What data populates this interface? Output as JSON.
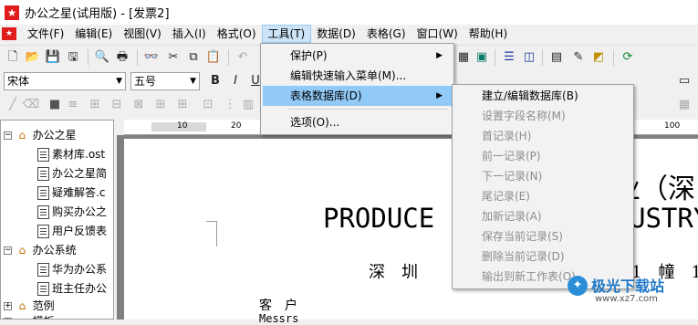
{
  "window": {
    "title": "办公之星(试用版) - [发票2]"
  },
  "menubar": {
    "items": [
      "文件(F)",
      "编辑(E)",
      "视图(V)",
      "插入(I)",
      "格式(O)",
      "工具(T)",
      "数据(D)",
      "表格(G)",
      "窗口(W)",
      "帮助(H)"
    ],
    "active": "工具(T)"
  },
  "format_bar": {
    "font_name": "宋体",
    "font_size": "五号"
  },
  "tools_menu": {
    "items": [
      {
        "label": "保护(P)",
        "submenu": true
      },
      {
        "label": "编辑快速输入菜单(M)...",
        "submenu": false
      },
      {
        "label": "表格数据库(D)",
        "submenu": true,
        "highlighted": true
      },
      {
        "label": "选项(O)...",
        "submenu": false
      }
    ]
  },
  "database_submenu": {
    "items": [
      {
        "label": "建立/编辑数据库(B)",
        "enabled": true
      },
      {
        "label": "设置字段名称(M)",
        "enabled": false
      },
      {
        "label": "首记录(H)",
        "enabled": false
      },
      {
        "label": "前一记录(P)",
        "enabled": false
      },
      {
        "label": "下一记录(N)",
        "enabled": false
      },
      {
        "label": "尾记录(E)",
        "enabled": false
      },
      {
        "label": "加新记录(A)",
        "enabled": false
      },
      {
        "label": "保存当前记录(S)",
        "enabled": false
      },
      {
        "label": "删除当前记录(D)",
        "enabled": false
      },
      {
        "label": "输出到新工作表(O)",
        "enabled": false
      }
    ]
  },
  "tree": {
    "nodes": [
      {
        "label": "办公之星",
        "type": "folder",
        "expanded": true
      },
      {
        "label": "素材库.ost",
        "type": "doc"
      },
      {
        "label": "办公之星简",
        "type": "doc"
      },
      {
        "label": "疑难解答.c",
        "type": "doc"
      },
      {
        "label": "购买办公之",
        "type": "doc"
      },
      {
        "label": "用户反馈表",
        "type": "doc"
      },
      {
        "label": "办公系统",
        "type": "folder",
        "expanded": true
      },
      {
        "label": "华为办公系",
        "type": "doc"
      },
      {
        "label": "班主任办公",
        "type": "doc"
      },
      {
        "label": "范例",
        "type": "folder",
        "expanded": false
      },
      {
        "label": "模板",
        "type": "folder",
        "expanded": false
      }
    ]
  },
  "ruler": {
    "ticks": [
      "10",
      "20",
      "100"
    ]
  },
  "document": {
    "title_cn_partial": "业（深",
    "title_en_left": "PRODUCE",
    "title_en_right": "USTRY",
    "subtitle_left": "深　圳",
    "subtitle_right": "1　幢　1",
    "customer_label": "客　户",
    "messrs_label": "Messrs"
  },
  "watermark": {
    "text": "极光下载站",
    "url": "www.xz7.com"
  },
  "colors": {
    "accent_highlight": "#91c9f7",
    "menu_active": "#cce4f7",
    "app_icon": "#e01b1b"
  }
}
